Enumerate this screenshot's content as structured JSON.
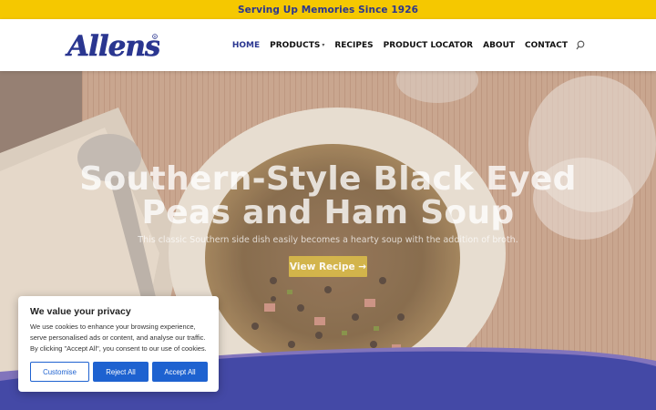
{
  "topbar": {
    "text": "Serving Up Memories Since 1926"
  },
  "header": {
    "logo_text": "Allens",
    "nav": [
      {
        "label": "HOME",
        "active": true,
        "dropdown": false
      },
      {
        "label": "PRODUCTS",
        "active": false,
        "dropdown": true
      },
      {
        "label": "RECIPES",
        "active": false,
        "dropdown": false
      },
      {
        "label": "PRODUCT LOCATOR",
        "active": false,
        "dropdown": false
      },
      {
        "label": "ABOUT",
        "active": false,
        "dropdown": false
      },
      {
        "label": "CONTACT",
        "active": false,
        "dropdown": false
      }
    ],
    "search_icon": "search-icon"
  },
  "hero": {
    "title_line1": "Southern-Style Black Eyed",
    "title_line2": "Peas and Ham Soup",
    "subtitle": "This classic Southern side dish easily becomes a hearty soup with the addition of broth.",
    "button_label": "View Recipe →"
  },
  "cookie": {
    "title": "We value your privacy",
    "text": "We use cookies to enhance your browsing experience, serve personalised ads or content, and analyse our traffic. By clicking \"Accept All\", you consent to our use of cookies.",
    "customise": "Customise",
    "reject": "Reject All",
    "accept": "Accept All"
  },
  "colors": {
    "brand_blue": "#2a3690",
    "topbar_yellow": "#f5c800",
    "button_blue": "#1e62d0"
  }
}
